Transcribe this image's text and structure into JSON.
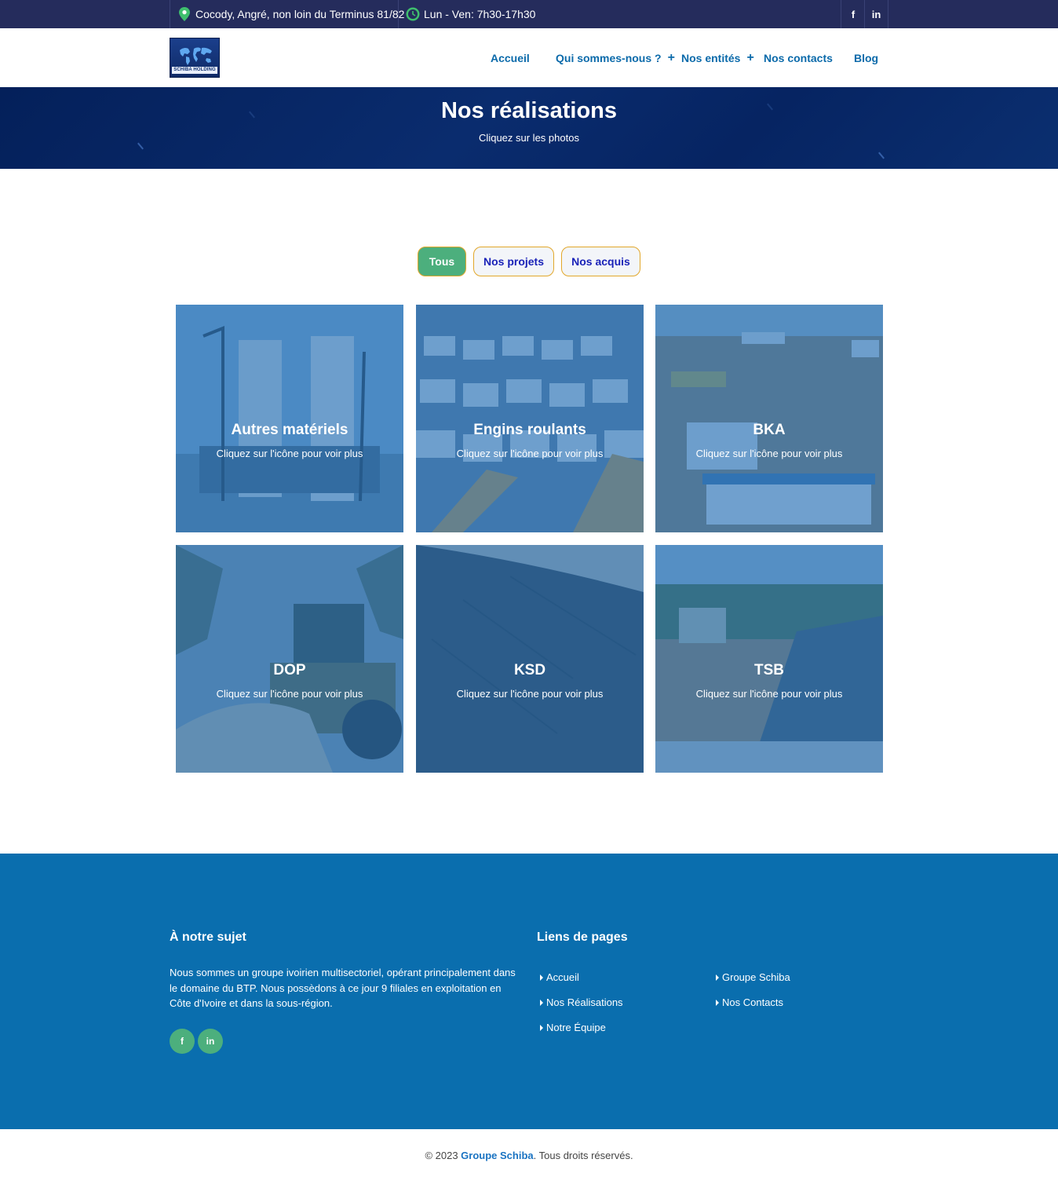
{
  "topbar": {
    "address": "Cocody, Angré, non loin du Terminus 81/82",
    "hours": "Lun - Ven: 7h30-17h30",
    "address_icon": "location-pin-icon",
    "hours_icon": "clock-icon",
    "social": [
      {
        "icon": "facebook-icon",
        "glyph": "f"
      },
      {
        "icon": "linkedin-icon",
        "glyph": "in"
      }
    ]
  },
  "logo": {
    "text": "SCHIBA HOLDING"
  },
  "nav": {
    "items": [
      {
        "label": "Accueil",
        "has_submenu": false
      },
      {
        "label": "Qui sommes-nous ?",
        "has_submenu": true
      },
      {
        "label": "Nos entités",
        "has_submenu": true
      },
      {
        "label": "Nos contacts",
        "has_submenu": false
      },
      {
        "label": "Blog",
        "has_submenu": false
      }
    ],
    "submenu_glyph": "+"
  },
  "hero": {
    "title": "Nos réalisations",
    "subtitle": "Cliquez sur les photos"
  },
  "filters": [
    {
      "label": "Tous",
      "active": true
    },
    {
      "label": "Nos projets",
      "active": false
    },
    {
      "label": "Nos acquis",
      "active": false
    }
  ],
  "gallery": [
    {
      "title": "Autres matériels",
      "subtitle": "Cliquez sur l'icône pour voir plus"
    },
    {
      "title": "Engins roulants",
      "subtitle": "Cliquez sur l'icône pour voir plus"
    },
    {
      "title": "BKA",
      "subtitle": "Cliquez sur l'icône pour voir plus"
    },
    {
      "title": "DOP",
      "subtitle": "Cliquez sur l'icône pour voir plus"
    },
    {
      "title": "KSD",
      "subtitle": "Cliquez sur l'icône pour voir plus"
    },
    {
      "title": "TSB",
      "subtitle": "Cliquez sur l'icône pour voir plus"
    }
  ],
  "footer": {
    "about_title": "À notre sujet",
    "about_text": "Nous sommes un groupe ivoirien multisectoriel, opérant principalement dans le domaine du BTP. Nous possèdons à ce jour 9 filiales en exploitation en Côte d'Ivoire et dans la sous-région.",
    "links_title": "Liens de pages",
    "links": [
      {
        "label": "Accueil"
      },
      {
        "label": "Groupe Schiba"
      },
      {
        "label": "Nos Réalisations"
      },
      {
        "label": "Nos Contacts"
      },
      {
        "label": "Notre Équipe"
      }
    ],
    "social": [
      {
        "icon": "facebook-icon",
        "glyph": "f"
      },
      {
        "icon": "linkedin-icon",
        "glyph": "in"
      }
    ]
  },
  "copyright": {
    "prefix": "© 2023 ",
    "brand": "Groupe Schiba",
    "suffix": ". Tous droits réservés."
  },
  "colors": {
    "topbar_bg": "#252c5c",
    "nav_link": "#0b6aaa",
    "accent_green": "#4caf7d",
    "filter_border": "#e2a72a",
    "footer_bg": "#0a6eae",
    "overlay": "#226eb4"
  }
}
